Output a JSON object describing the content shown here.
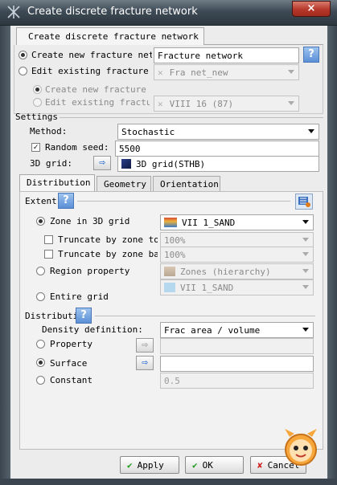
{
  "window": {
    "title": "Create discrete fracture network",
    "close_symbol": "×"
  },
  "tab_main": "Create discrete fracture network",
  "mode": {
    "create_new_label": "Create new fracture netwo",
    "create_new_value": "Fracture network",
    "edit_existing_label": "Edit existing fracture ne",
    "edit_existing_value": "Fra net_new",
    "sub_create_label": "Create new fracture se",
    "sub_edit_label": "Edit existing fracture",
    "sub_edit_value": "VIII 16 (87)"
  },
  "settings": {
    "header": "Settings",
    "method_label": "Method:",
    "method_value": "Stochastic",
    "random_seed_label": "Random seed:",
    "random_seed_value": "5500",
    "grid_label": "3D grid:",
    "grid_value": "3D grid(STHB)"
  },
  "tabs": [
    "Distribution",
    "Geometry",
    "Orientation"
  ],
  "extent": {
    "header": "Extent",
    "zone_label": "Zone in 3D grid",
    "zone_value": "VII 1_SAND",
    "trunc_top_label": "Truncate by zone top",
    "trunc_top_value": "100%",
    "trunc_base_label": "Truncate by zone base",
    "trunc_base_value": "100%",
    "region_label": "Region property",
    "region_value": "Zones (hierarchy)",
    "region_sub_value": "VII 1_SAND",
    "entire_grid_label": "Entire grid"
  },
  "distribution": {
    "header": "Distributio",
    "density_label": "Density definition:",
    "density_value": "Frac area / volume",
    "property_label": "Property",
    "property_value": "",
    "surface_label": "Surface",
    "surface_value": "",
    "constant_label": "Constant",
    "constant_value": "0.5"
  },
  "buttons": {
    "apply": "Apply",
    "ok": "OK",
    "cancel": "Cancel",
    "checkmark": "✔",
    "cross": "✘"
  },
  "icons": {
    "help_glyph": "?",
    "arrow_glyph": "⇨"
  },
  "colors": {
    "accent_blue": "#2f6fd1",
    "titlebar": "#3e4a55"
  }
}
